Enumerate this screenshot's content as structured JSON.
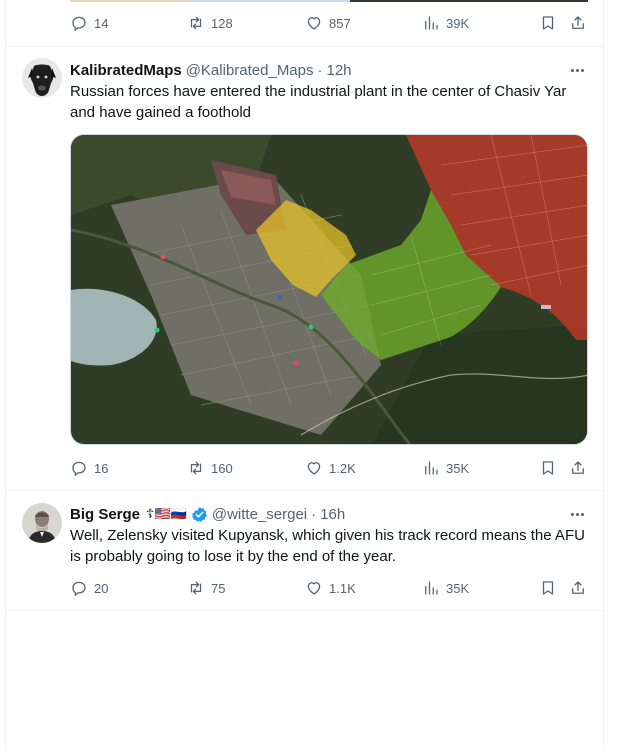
{
  "top_tweet": {
    "actions": {
      "replies": "14",
      "reposts": "128",
      "likes": "857",
      "views": "39K"
    }
  },
  "tweets": [
    {
      "display_name": "KalibratedMaps",
      "handle": "@Kalibrated_Maps",
      "time_sep": "·",
      "time": "12h",
      "text": "Russian forces have entered the industrial plant in the center of Chasiv Yar and have gained a foothold",
      "actions": {
        "replies": "16",
        "reposts": "160",
        "likes": "1.2K",
        "views": "35K"
      }
    },
    {
      "display_name": "Big Serge",
      "name_emoji": "☦🇺🇸🇷🇺",
      "handle": "@witte_sergei",
      "time_sep": "·",
      "time": "16h",
      "text": "Well, Zelensky visited Kupyansk, which given his track record means the AFU is probably going to lose it by the end of the year.",
      "actions": {
        "replies": "20",
        "reposts": "75",
        "likes": "1.1K",
        "views": "35K"
      }
    }
  ],
  "icons": {
    "reply": "reply-icon",
    "repost": "repost-icon",
    "like": "heart-icon",
    "views": "views-icon",
    "bookmark": "bookmark-icon",
    "share": "share-icon",
    "more": "more-icon",
    "verified": "verified-icon"
  },
  "colors": {
    "secondary_text": "#536471",
    "border": "#eff3f4",
    "verified": "#1d9bf0",
    "map_red_zone": "#c0392b",
    "map_yellow_zone": "#e6c229",
    "map_green_zone": "#6fae2a"
  }
}
